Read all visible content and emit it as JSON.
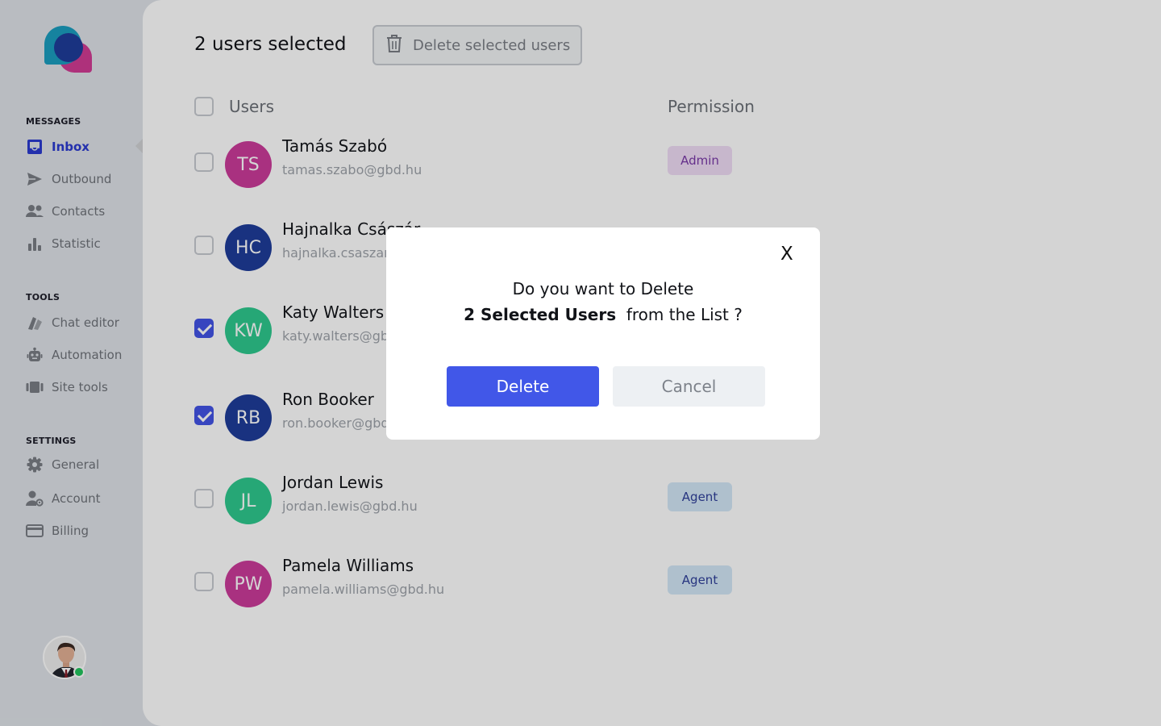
{
  "sidebar": {
    "sections": [
      {
        "title": "MESSAGES"
      },
      {
        "title": "TOOLS"
      },
      {
        "title": "SETTINGS"
      }
    ],
    "items": [
      {
        "label": "Inbox",
        "icon": "inbox-icon",
        "active": true
      },
      {
        "label": "Outbound",
        "icon": "send-icon"
      },
      {
        "label": "Contacts",
        "icon": "contacts-icon"
      },
      {
        "label": "Statistic",
        "icon": "statistic-icon"
      },
      {
        "label": "Chat editor",
        "icon": "chat-editor-icon"
      },
      {
        "label": "Automation",
        "icon": "robot-icon"
      },
      {
        "label": "Site tools",
        "icon": "site-tools-icon"
      },
      {
        "label": "General",
        "icon": "gear-icon"
      },
      {
        "label": "Account",
        "icon": "account-settings-icon"
      },
      {
        "label": "Billing",
        "icon": "credit-card-icon"
      }
    ],
    "user_status": "online"
  },
  "header": {
    "selected_count": "2 users selected",
    "delete_selected_label": "Delete selected users"
  },
  "table": {
    "columns": [
      "Users",
      "Permission"
    ],
    "rows": [
      {
        "initials": "TS",
        "name": "Tamás Szabó",
        "email": "tamas.szabo@gbd.hu",
        "permission": "Admin",
        "checked": false,
        "avatar_color": "#cc3c9a"
      },
      {
        "initials": "HC",
        "name": "Hajnalka Császár",
        "email": "hajnalka.csaszar@gbd.hu",
        "permission": "",
        "checked": false,
        "avatar_color": "#1f3d9a"
      },
      {
        "initials": "KW",
        "name": "Katy Walters",
        "email": "katy.walters@gbd.hu",
        "permission": "",
        "checked": true,
        "avatar_color": "#2ec98e"
      },
      {
        "initials": "RB",
        "name": "Ron Booker",
        "email": "ron.booker@gbd.hu",
        "permission": "",
        "checked": true,
        "avatar_color": "#1f3d9a"
      },
      {
        "initials": "JL",
        "name": "Jordan Lewis",
        "email": "jordan.lewis@gbd.hu",
        "permission": "Agent",
        "checked": false,
        "avatar_color": "#2ec98e"
      },
      {
        "initials": "PW",
        "name": "Pamela Williams",
        "email": "pamela.williams@gbd.hu",
        "permission": "Agent",
        "checked": false,
        "avatar_color": "#cc3c9a"
      }
    ]
  },
  "modal": {
    "close_label": "X",
    "line1": "Do you want to Delete",
    "line2_bold": "2 Selected Users",
    "line2_rest": "from the List ?",
    "delete_label": "Delete",
    "cancel_label": "Cancel"
  },
  "colors": {
    "accent": "#4157e8",
    "admin_badge_bg": "#f0dcf6",
    "admin_badge_text": "#7a3aa8",
    "agent_badge_bg": "#d3e7f7",
    "agent_badge_text": "#30409a"
  }
}
